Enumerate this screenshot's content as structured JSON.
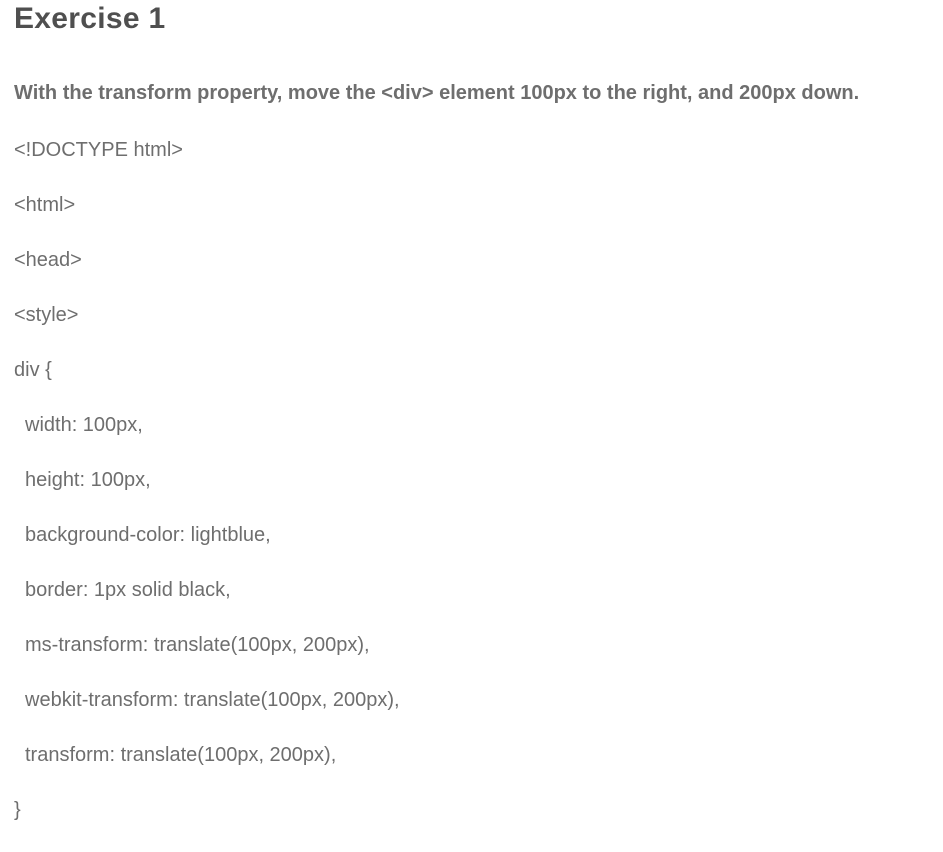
{
  "title": "Exercise 1",
  "instruction": "With the transform property, move the <div> element 100px to the right, and 200px down.",
  "code_lines": [
    {
      "text": "<!DOCTYPE html>",
      "indent": false
    },
    {
      "text": "<html>",
      "indent": false
    },
    {
      "text": "<head>",
      "indent": false
    },
    {
      "text": "<style>",
      "indent": false
    },
    {
      "text": "div {",
      "indent": false
    },
    {
      "text": "width: 100px,",
      "indent": true
    },
    {
      "text": "height: 100px,",
      "indent": true
    },
    {
      "text": "background-color: lightblue,",
      "indent": true
    },
    {
      "text": "border: 1px solid black,",
      "indent": true
    },
    {
      "text": "ms-transform: translate(100px, 200px),",
      "indent": true
    },
    {
      "text": "webkit-transform: translate(100px, 200px),",
      "indent": true
    },
    {
      "text": "transform: translate(100px, 200px),",
      "indent": true
    },
    {
      "text": "}",
      "indent": false
    }
  ]
}
